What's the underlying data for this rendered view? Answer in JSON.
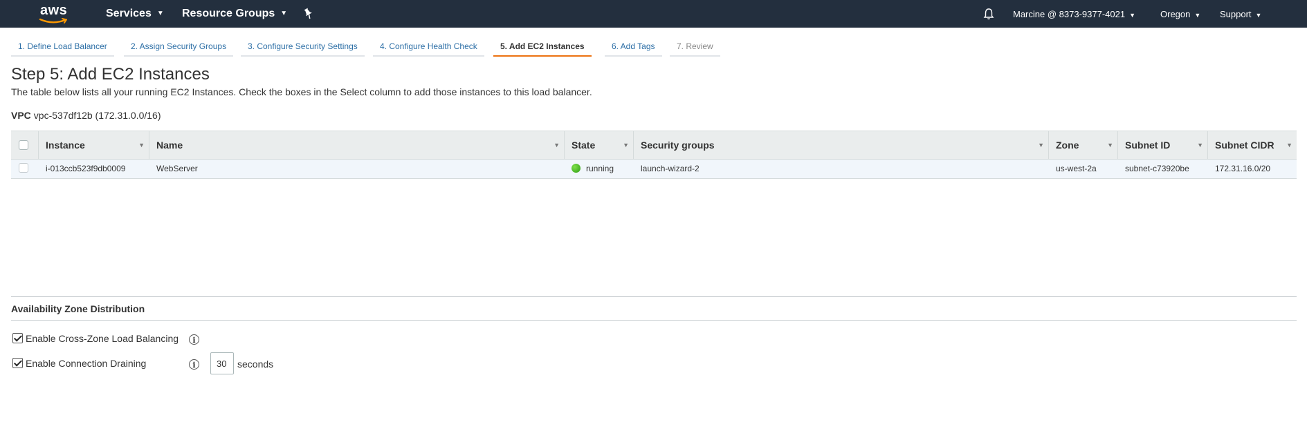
{
  "nav": {
    "logo_text": "aws",
    "services": "Services",
    "resource_groups": "Resource Groups",
    "account": "Marcine @ 8373-9377-4021",
    "region": "Oregon",
    "support": "Support",
    "icons": {
      "pin": "pin-icon",
      "bell": "bell-icon"
    },
    "colors": {
      "bar": "#232f3e",
      "accent": "#ff9900"
    }
  },
  "tabs": [
    {
      "label": "1. Define Load Balancer",
      "state": "link"
    },
    {
      "label": "2. Assign Security Groups",
      "state": "link"
    },
    {
      "label": "3. Configure Security Settings",
      "state": "link"
    },
    {
      "label": "4. Configure Health Check",
      "state": "link"
    },
    {
      "label": "5. Add EC2 Instances",
      "state": "active"
    },
    {
      "label": "6. Add Tags",
      "state": "link"
    },
    {
      "label": "7. Review",
      "state": "disabled"
    }
  ],
  "page": {
    "title": "Step 5: Add EC2 Instances",
    "description": "The table below lists all your running EC2 Instances. Check the boxes in the Select column to add those instances to this load balancer.",
    "vpc_label": "VPC",
    "vpc_value": "vpc-537df12b (172.31.0.0/16)"
  },
  "table": {
    "columns": [
      "Instance",
      "Name",
      "State",
      "Security groups",
      "Zone",
      "Subnet ID",
      "Subnet CIDR"
    ],
    "rows": [
      {
        "instance": "i-013ccb523f9db0009",
        "name": "WebServer",
        "state": "running",
        "security_groups": "launch-wizard-2",
        "zone": "us-west-2a",
        "subnet_id": "subnet-c73920be",
        "subnet_cidr": "172.31.16.0/20",
        "selected": false
      }
    ]
  },
  "az": {
    "title": "Availability Zone Distribution",
    "cross_zone_label": "Enable Cross-Zone Load Balancing",
    "cross_zone_checked": true,
    "draining_label": "Enable Connection Draining",
    "draining_checked": true,
    "draining_timeout": "30",
    "seconds_label": "seconds",
    "info_glyph": "i"
  }
}
